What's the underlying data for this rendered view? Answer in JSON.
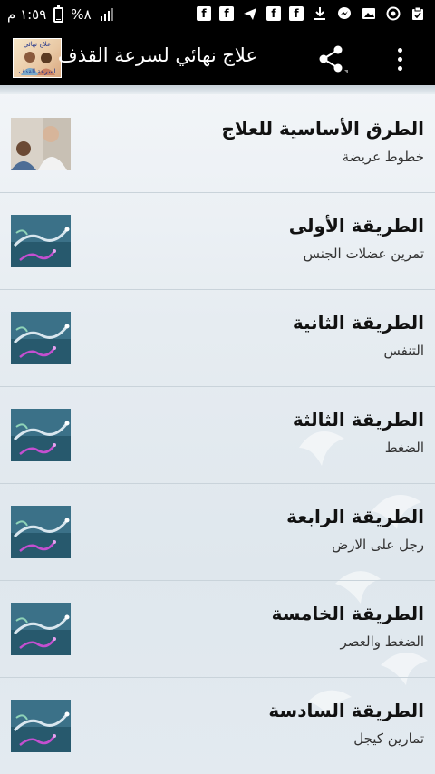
{
  "status_bar": {
    "time": "١:٥٩ م",
    "battery": "%٨",
    "battery_level": 0.08,
    "notification_icons": [
      "facebook-icon",
      "facebook-icon",
      "telegram-icon",
      "facebook-icon",
      "facebook-icon",
      "download-icon",
      "messenger-icon",
      "image-icon",
      "circle-icon",
      "clipboard-icon"
    ],
    "icon_color": "#ffffff"
  },
  "app_bar": {
    "title": "علاج نهائي لسرعة القذف",
    "logo_text_top": "علاج نهائي",
    "logo_text_bottom": "لسرعة القذف",
    "background": "#000000"
  },
  "items": [
    {
      "title": "الطرق الأساسية للعلاج",
      "subtitle": "خطوط عريضة",
      "thumb": "doctor-photo"
    },
    {
      "title": "الطريقة الأولى",
      "subtitle": "تمرين عضلات الجنس",
      "thumb": "sperm-graphic"
    },
    {
      "title": "الطريقة الثانية",
      "subtitle": "التنفس",
      "thumb": "sperm-graphic"
    },
    {
      "title": "الطريقة الثالثة",
      "subtitle": "الضغط",
      "thumb": "sperm-graphic"
    },
    {
      "title": "الطريقة الرابعة",
      "subtitle": "رجل على الارض",
      "thumb": "sperm-graphic"
    },
    {
      "title": "الطريقة الخامسة",
      "subtitle": "الضغط والعصر",
      "thumb": "sperm-graphic"
    },
    {
      "title": "الطريقة السادسة",
      "subtitle": "تمارين كيجل",
      "thumb": "sperm-graphic"
    }
  ]
}
